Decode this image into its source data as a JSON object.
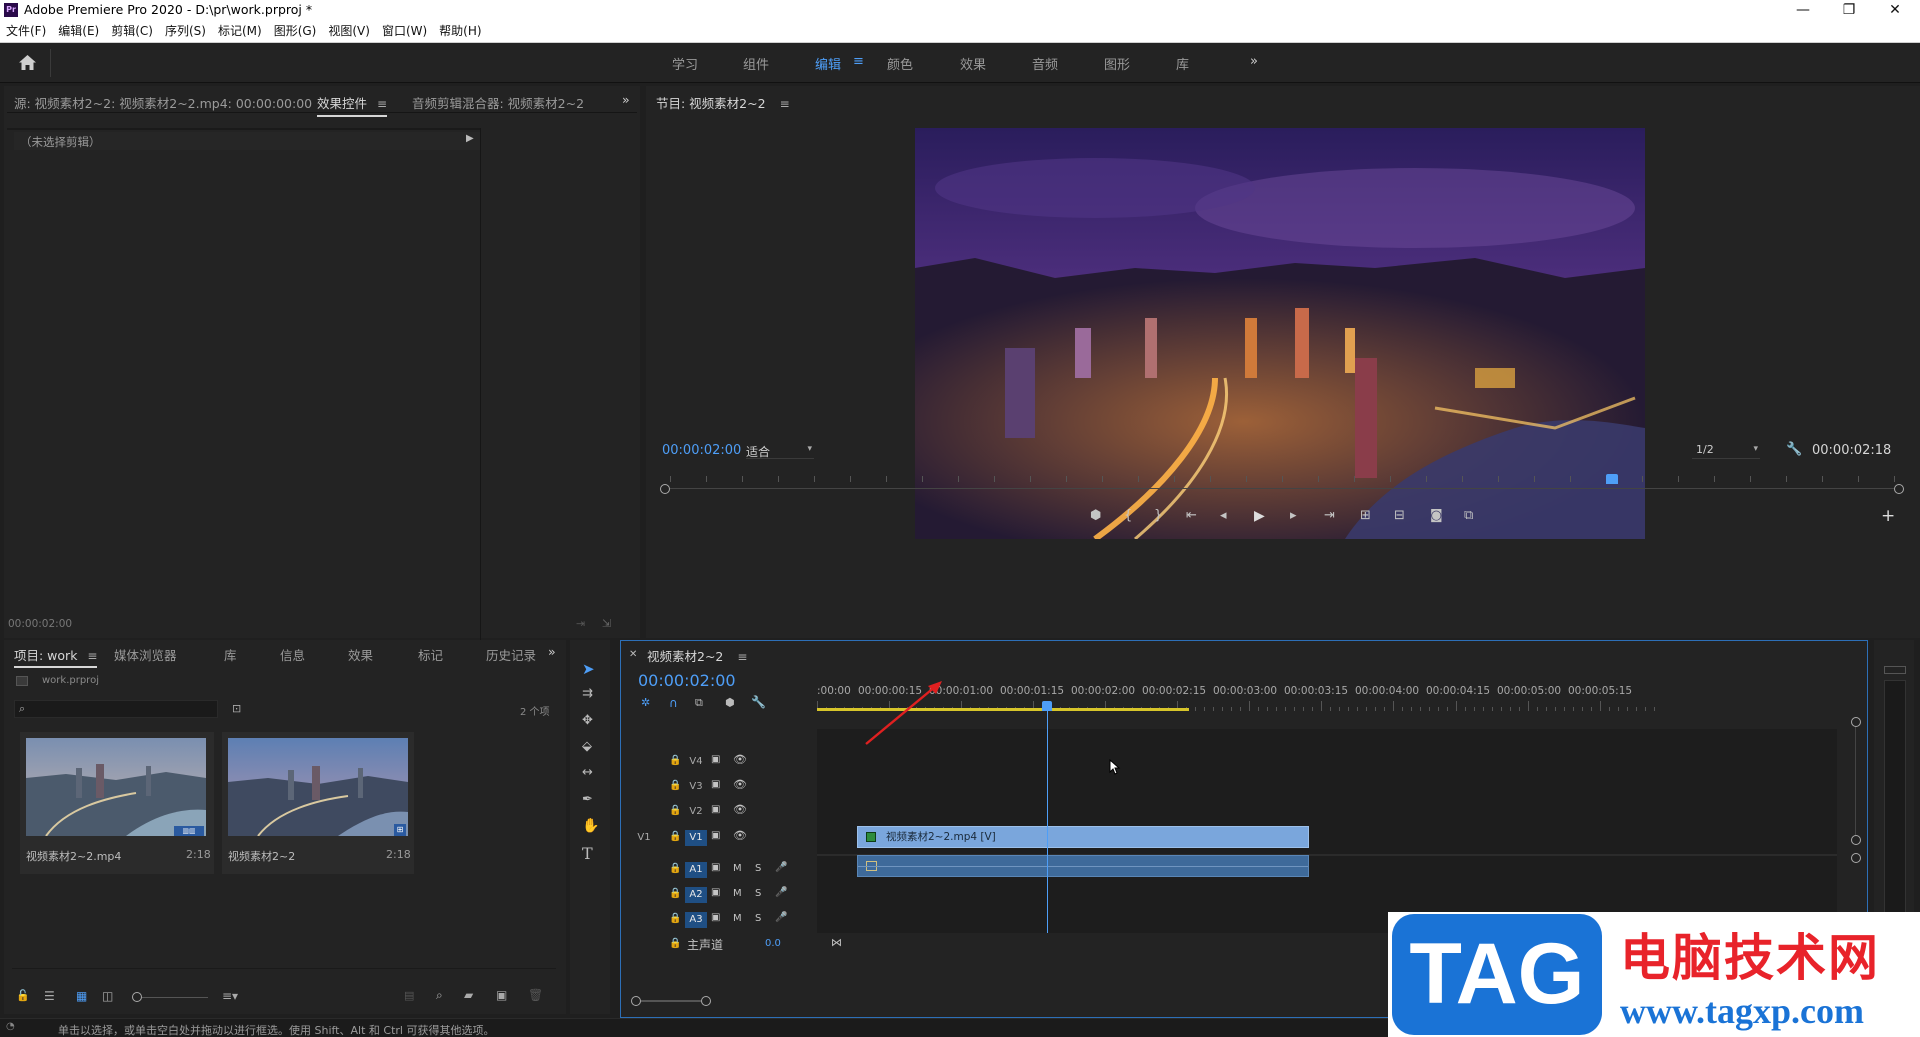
{
  "app": {
    "title": "Adobe Premiere Pro 2020 - D:\\pr\\work.prproj *",
    "logo_text": "Pr",
    "window_controls": {
      "minimize": "—",
      "maximize": "❐",
      "close": "✕"
    }
  },
  "menu": [
    "文件(F)",
    "编辑(E)",
    "剪辑(C)",
    "序列(S)",
    "标记(M)",
    "图形(G)",
    "视图(V)",
    "窗口(W)",
    "帮助(H)"
  ],
  "workspaces": {
    "items": [
      "学习",
      "组件",
      "编辑",
      "颜色",
      "效果",
      "音频",
      "图形",
      "库"
    ],
    "active": "编辑",
    "overflow": "»"
  },
  "source_panel": {
    "tabs": [
      "源: 视频素材2~2: 视频素材2~2.mp4: 00:00:00:00",
      "效果控件",
      "音频剪辑混合器: 视频素材2~2"
    ],
    "active_tab": "效果控件",
    "no_clip_text": "（未选择剪辑）",
    "timecode": "00:00:02:00"
  },
  "program_monitor": {
    "title": "节目: 视频素材2~2",
    "timecode": "00:00:02:00",
    "fit": "适合",
    "resolution": "1/2",
    "duration": "00:00:02:18",
    "playhead_fraction": 0.77
  },
  "project_panel": {
    "tabs": [
      "项目: work",
      "媒体浏览器",
      "库",
      "信息",
      "效果",
      "标记",
      "历史记录"
    ],
    "active_tab": "项目: work",
    "project_file": "work.prproj",
    "item_count": "2 个项",
    "items": [
      {
        "name": "视频素材2~2.mp4",
        "duration": "2:18"
      },
      {
        "name": "视频素材2~2",
        "duration": "2:18"
      }
    ]
  },
  "timeline": {
    "sequence_name": "视频素材2~2",
    "timecode": "00:00:02:00",
    "ruler_ticks": [
      ":00:00",
      "00:00:00:15",
      "00:00:01:00",
      "00:00:01:15",
      "00:00:02:00",
      "00:00:02:15",
      "00:00:03:00",
      "00:00:03:15",
      "00:00:04:00",
      "00:00:04:15",
      "00:00:05:00",
      "00:00:05:15"
    ],
    "video_tracks": [
      "V4",
      "V3",
      "V2",
      "V1"
    ],
    "source_patch": "V1",
    "audio_tracks": [
      "A1",
      "A2",
      "A3"
    ],
    "mute_label": "M",
    "solo_label": "S",
    "master_label": "主声道",
    "master_value": "0.0",
    "video_clip_label": "视频素材2~2.mp4 [V]",
    "playhead_seconds": 2.0
  },
  "status_bar": "单击以选择，或单击空白处并拖动以进行框选。使用 Shift、Alt 和 Ctrl 可获得其他选项。",
  "watermark": {
    "badge": "TAG",
    "name": "电脑技术网",
    "url": "www.tagxp.com"
  },
  "colors": {
    "accent": "#4e9ef7",
    "clip_video": "#7aa6dc",
    "clip_audio": "#3e6a9a",
    "watermark_red": "#e8232a",
    "watermark_blue": "#1a73d6"
  }
}
